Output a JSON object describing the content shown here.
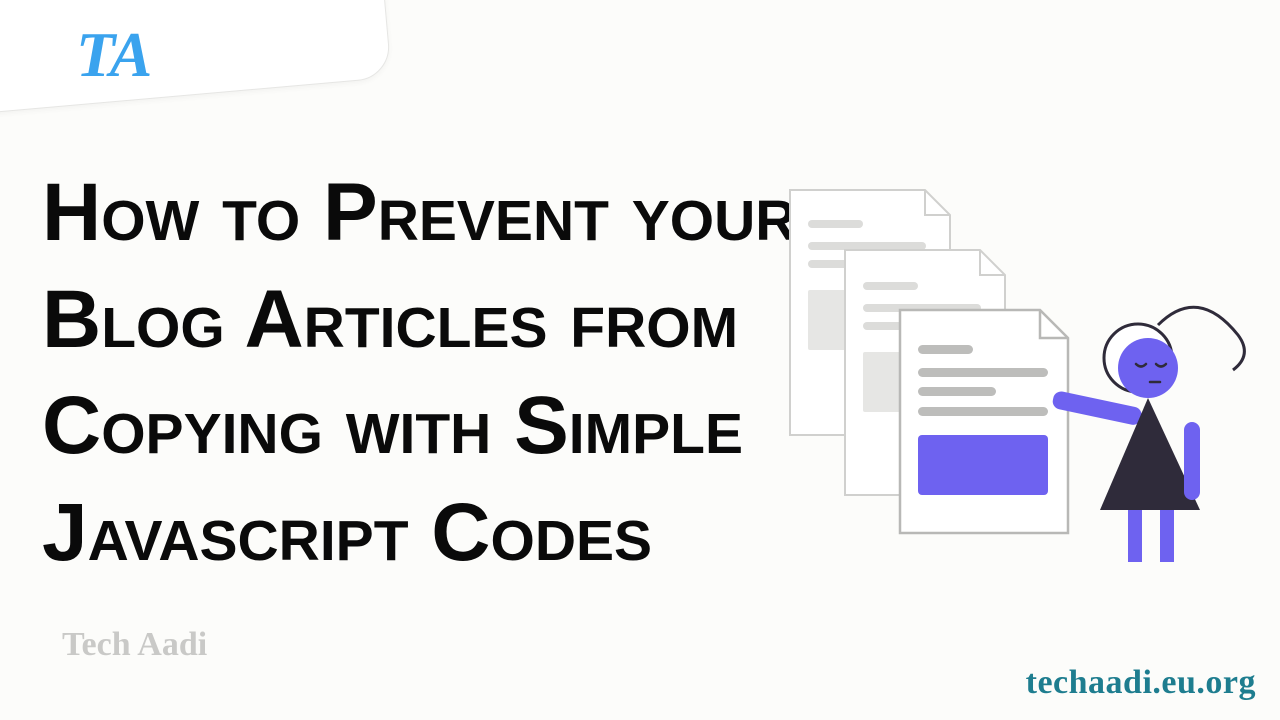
{
  "brand": {
    "logo_text": "TA"
  },
  "headline": "How to Prevent your Blog Articles from Copying with Simple Javascript Codes",
  "author": "Tech Aadi",
  "site_url": "techaadi.eu.org",
  "colors": {
    "logo": "#3aa3ee",
    "headline": "#0a0a0a",
    "author": "#c9c9c7",
    "url": "#1e7d8f",
    "accent_purple": "#6e62f0",
    "accent_dark": "#2f2b3a",
    "paper_stroke": "#d0d0ce",
    "paper_line": "#d6d6d4",
    "paper_block": "#e2e2e0"
  }
}
